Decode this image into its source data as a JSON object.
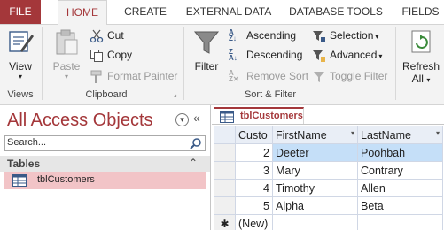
{
  "tabs": {
    "file": "FILE",
    "home": "HOME",
    "create": "CREATE",
    "external_data": "EXTERNAL DATA",
    "database_tools": "DATABASE TOOLS",
    "fields": "FIELDS"
  },
  "ribbon": {
    "views": {
      "view": "View",
      "group": "Views"
    },
    "clipboard": {
      "paste": "Paste",
      "cut": "Cut",
      "copy": "Copy",
      "format_painter": "Format Painter",
      "group": "Clipboard"
    },
    "sort_filter": {
      "filter": "Filter",
      "ascending": "Ascending",
      "descending": "Descending",
      "remove_sort": "Remove Sort",
      "selection": "Selection",
      "advanced": "Advanced",
      "toggle_filter": "Toggle Filter",
      "group": "Sort & Filter"
    },
    "records": {
      "refresh": "Refresh",
      "refresh_all": "All"
    }
  },
  "nav": {
    "title": "All Access Objects",
    "search_placeholder": "Search...",
    "section": "Tables",
    "items": [
      "tblCustomers"
    ]
  },
  "document": {
    "tab_label": "tblCustomers",
    "columns": [
      "Custo",
      "FirstName",
      "LastName"
    ],
    "rows": [
      {
        "id": "2",
        "first": "Deeter",
        "last": "Poohbah"
      },
      {
        "id": "3",
        "first": "Mary",
        "last": "Contrary"
      },
      {
        "id": "4",
        "first": "Timothy",
        "last": "Allen"
      },
      {
        "id": "5",
        "first": "Alpha",
        "last": "Beta"
      }
    ],
    "new_row_marker": "✱",
    "new_row_label": "(New)"
  },
  "colors": {
    "accent": "#a4373a",
    "selected_cell": "#c5dff8",
    "nav_selected": "#f2c4c7"
  }
}
